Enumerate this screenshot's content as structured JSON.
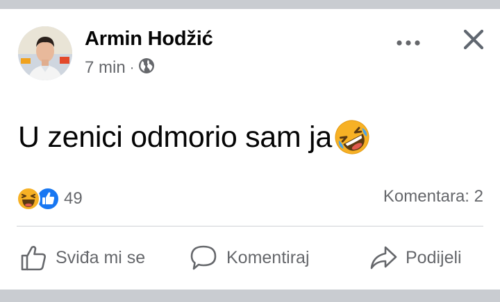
{
  "post": {
    "author": "Armin Hodžić",
    "time": "7 min",
    "separator": "·",
    "privacy_icon": "globe-icon",
    "text": "U zenici odmorio sam ja",
    "text_emoji": "rolling-on-floor-laughing-emoji"
  },
  "reactions": {
    "icons": [
      "haha-reaction-icon",
      "like-reaction-icon"
    ],
    "count": "49",
    "comments": "Komentara: 2"
  },
  "actions": {
    "like": "Sviđa mi se",
    "comment": "Komentiraj",
    "share": "Podijeli"
  },
  "colors": {
    "like_blue": "#1877f2",
    "haha_yellow": "#f7b125",
    "secondary_text": "#65676b"
  }
}
